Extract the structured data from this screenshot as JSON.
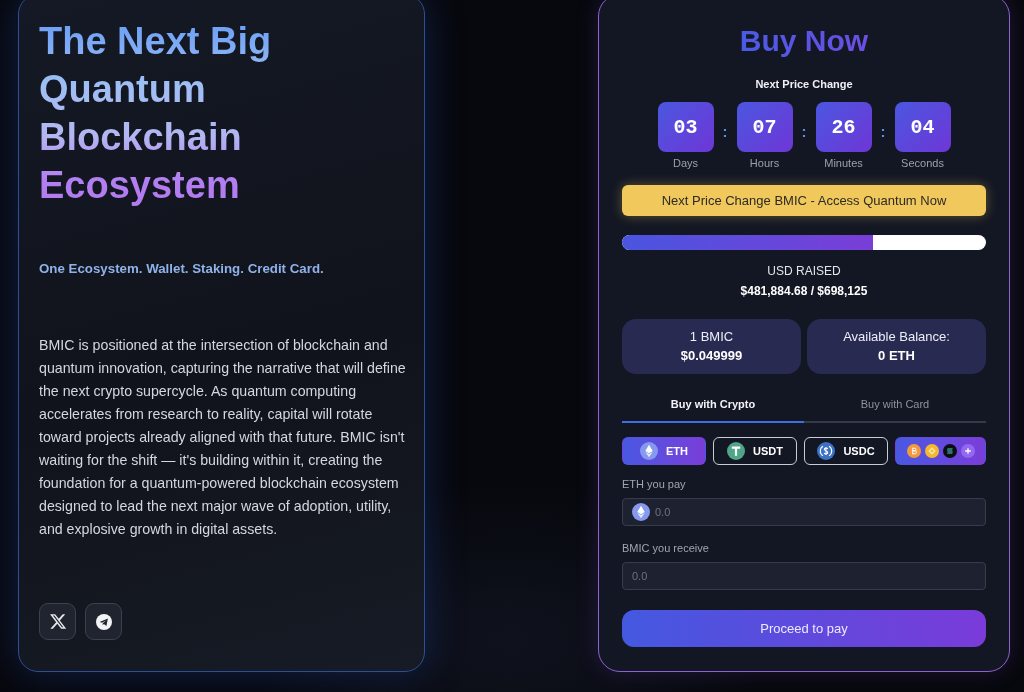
{
  "hero": {
    "title": "The Next Big Quantum Blockchain Ecosystem",
    "tagline": "One Ecosystem. Wallet. Staking. Credit Card.",
    "description": "BMIC is positioned at the intersection of blockchain and quantum innovation, capturing the narrative that will define the next crypto supercycle. As quantum computing accelerates from research to reality, capital will rotate toward projects already aligned with that future. BMIC isn't waiting for the shift — it's building within it, creating the foundation for a quantum-powered blockchain ecosystem designed to lead the next major wave of adoption, utility, and explosive growth in digital assets.",
    "social_links": [
      {
        "kind": "x"
      },
      {
        "kind": "telegram"
      }
    ]
  },
  "purchase": {
    "title": "Buy Now",
    "countdown_label": "Next Price Change",
    "countdown": [
      {
        "value": "03",
        "unit": "Days",
        "separator": ":"
      },
      {
        "value": "07",
        "unit": "Hours",
        "separator": ":"
      },
      {
        "value": "26",
        "unit": "Minutes",
        "separator": ":"
      },
      {
        "value": "04",
        "unit": "Seconds"
      }
    ],
    "banner": "Next Price Change BMIC - Access Quantum Now",
    "progress": {
      "level": 0.69
    },
    "raised_label": "USD RAISED",
    "raised_value": "$481,884.68 / $698,125",
    "info_cards": [
      {
        "label": "1 BMIC",
        "value": "$0.049999"
      },
      {
        "label": "Available Balance:",
        "value": "0 ETH"
      }
    ],
    "tabs": [
      {
        "label": "Buy with Crypto",
        "selected": true
      },
      {
        "label": "Buy with Card",
        "selected": false
      }
    ],
    "currencies": [
      {
        "kind": "eth",
        "label": "ETH",
        "selected": true
      },
      {
        "kind": "usdt",
        "label": "USDT",
        "selected": false
      },
      {
        "kind": "usdc",
        "label": "USDC",
        "selected": false
      },
      {
        "kind": "more",
        "selected": false
      }
    ],
    "fields": [
      {
        "kind": "coin",
        "label": "ETH you pay",
        "placeholder": "0.0"
      },
      {
        "kind": "plain",
        "label": "BMIC you receive",
        "placeholder": "0.0"
      }
    ],
    "button": "Proceed to pay"
  }
}
